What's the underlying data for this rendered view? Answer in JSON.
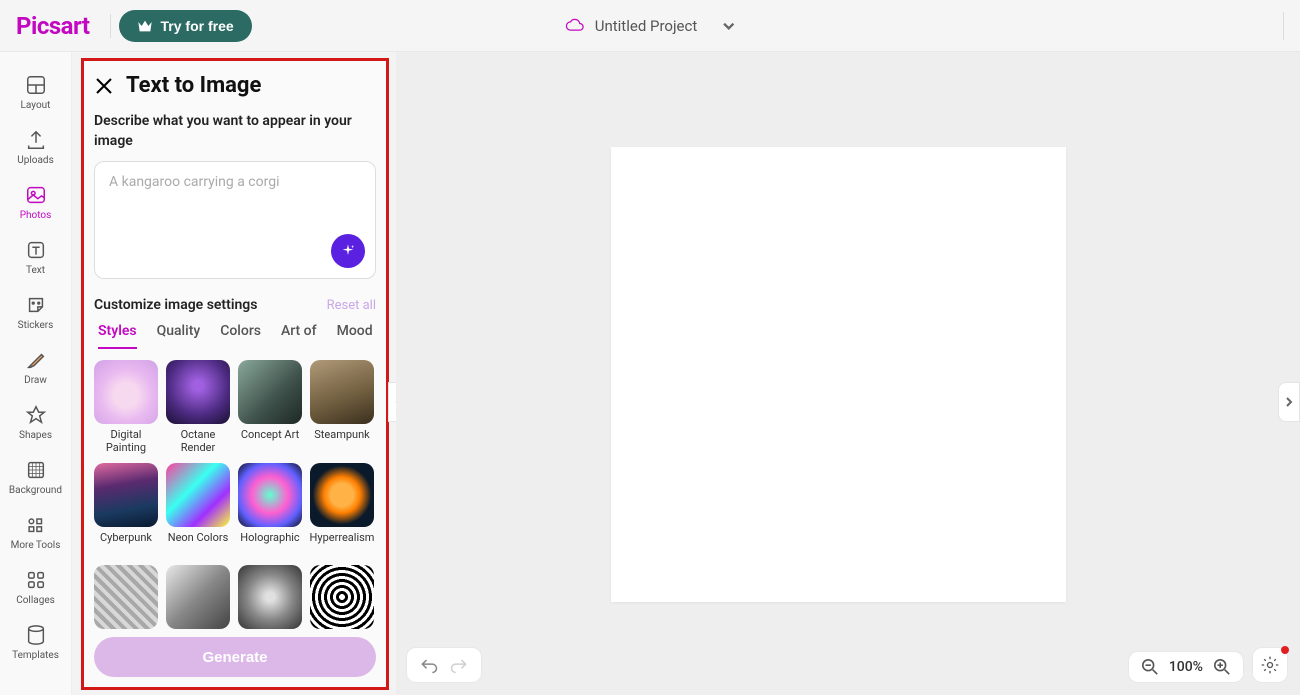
{
  "header": {
    "logo": "Picsart",
    "try_label": "Try for free",
    "project_name": "Untitled Project"
  },
  "leftrail": {
    "items": [
      {
        "label": "Layout"
      },
      {
        "label": "Uploads"
      },
      {
        "label": "Photos"
      },
      {
        "label": "Text"
      },
      {
        "label": "Stickers"
      },
      {
        "label": "Draw"
      },
      {
        "label": "Shapes"
      },
      {
        "label": "Background"
      },
      {
        "label": "More Tools"
      },
      {
        "label": "Collages"
      },
      {
        "label": "Templates"
      }
    ]
  },
  "panel": {
    "title": "Text to Image",
    "describe_label": "Describe what you want to appear in your image",
    "prompt_placeholder": "A kangaroo carrying a corgi",
    "customize_label": "Customize image settings",
    "reset_label": "Reset all",
    "tabs": [
      {
        "label": "Styles"
      },
      {
        "label": "Quality"
      },
      {
        "label": "Colors"
      },
      {
        "label": "Art of"
      },
      {
        "label": "Mood"
      }
    ],
    "styles": [
      {
        "name": "Digital Painting",
        "thumb": "th-digital"
      },
      {
        "name": "Octane Render",
        "thumb": "th-octane"
      },
      {
        "name": "Concept Art",
        "thumb": "th-concept"
      },
      {
        "name": "Steampunk",
        "thumb": "th-steam"
      },
      {
        "name": "Cyberpunk",
        "thumb": "th-cyber"
      },
      {
        "name": "Neon Colors",
        "thumb": "th-neon"
      },
      {
        "name": "Holographic",
        "thumb": "th-holo"
      },
      {
        "name": "Hyperrealism",
        "thumb": "th-hyper"
      },
      {
        "name": "",
        "thumb": "th-pencil"
      },
      {
        "name": "",
        "thumb": "th-illus"
      },
      {
        "name": "",
        "thumb": "th-macro"
      },
      {
        "name": "",
        "thumb": "th-zentangle"
      }
    ],
    "generate_label": "Generate"
  },
  "zoom": {
    "percent": "100%"
  }
}
